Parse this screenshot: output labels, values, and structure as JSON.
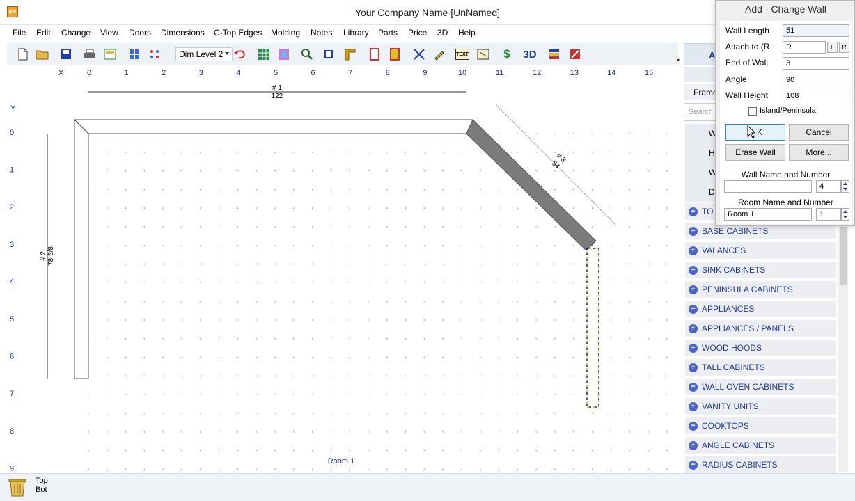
{
  "window": {
    "title": "Your Company Name [UnNamed]",
    "app_icon": "HCD"
  },
  "menu": [
    "File",
    "Edit",
    "Change",
    "View",
    "Doors",
    "Dimensions",
    "C-Top Edges",
    "Molding",
    "Notes",
    "Library",
    "Parts",
    "Price",
    "3D",
    "Help"
  ],
  "toolbar": {
    "dim_level": "Dim Level 2",
    "text_btn": "TEXT",
    "dollar_btn": "$",
    "three_d_btn": "3D",
    "icons": [
      "new-file-icon",
      "open-folder-icon",
      "save-icon",
      "print-icon",
      "layout-icon",
      "grid-icon",
      "dots-grid-icon",
      "undo-icon",
      "add-grid-icon",
      "color-grid-icon",
      "zoom-in-icon",
      "zoom-window-icon",
      "wall-icon",
      "door-icon",
      "cabinet-icon",
      "cross-icon",
      "pencil-icon",
      "text-icon",
      "line-icon",
      "price-icon",
      "3d-icon",
      "color-bars-icon",
      "erase-icon"
    ]
  },
  "drawing": {
    "x_label": "X",
    "y_label": "Y",
    "x_ticks": [
      "0",
      "1",
      "2",
      "3",
      "4",
      "5",
      "6",
      "7",
      "8",
      "9",
      "10",
      "11",
      "12",
      "13",
      "14",
      "15"
    ],
    "y_ticks": [
      "0",
      "1",
      "2",
      "3",
      "4",
      "5",
      "6",
      "7",
      "8",
      "9"
    ],
    "room_label": "Room 1",
    "dim1": {
      "name": "# 1",
      "value": "122"
    },
    "dim2": {
      "name": "# 2",
      "value": "78 5/8"
    },
    "dim3": {
      "name": "# 3",
      "value": "54"
    }
  },
  "sidebar": {
    "tab_label": "Ad",
    "frame_label": "Frame",
    "search_placeholder": "Search",
    "hidden_letters": [
      "W",
      "H",
      "W",
      "D"
    ],
    "partial_category": "TO",
    "categories": [
      "BASE CABINETS",
      "VALANCES",
      "SINK CABINETS",
      "PENINSULA CABINETS",
      "APPLIANCES",
      "APPLIANCES / PANELS",
      "WOOD HOODS",
      "TALL CABINETS",
      "WALL OVEN CABINETS",
      "VANITY UNITS",
      "COOKTOPS",
      "ANGLE CABINETS",
      "RADIUS CABINETS"
    ]
  },
  "dialog": {
    "title": "Add - Change Wall",
    "wall_length_label": "Wall Length",
    "wall_length_value": "51",
    "attach_label": "Attach to (R",
    "attach_value": "R",
    "attach_left_btn": "L",
    "attach_right_btn": "R",
    "end_of_wall_label": "End of Wall",
    "end_of_wall_value": "3",
    "angle_label": "Angle",
    "angle_value": "90",
    "wall_height_label": "Wall Height",
    "wall_height_value": "108",
    "island_label": "Island/Peninsula",
    "ok_label": "K",
    "cancel_label": "Cancel",
    "erase_label": "Erase Wall",
    "more_label": "More...",
    "wall_name_label": "Wall Name and Number",
    "wall_name_value": "",
    "wall_number_value": "4",
    "room_name_label": "Room Name and Number",
    "room_name_value": "Room 1",
    "room_number_value": "1"
  },
  "status": {
    "top": "Top",
    "bot": "Bot"
  },
  "colors": {
    "wall_fill": "#7b7b7b",
    "selection": "#1212cc",
    "selection_dash": "#e8d400",
    "category_text": "#1f3a9a",
    "coordinate_text": "#1a2a8a"
  }
}
